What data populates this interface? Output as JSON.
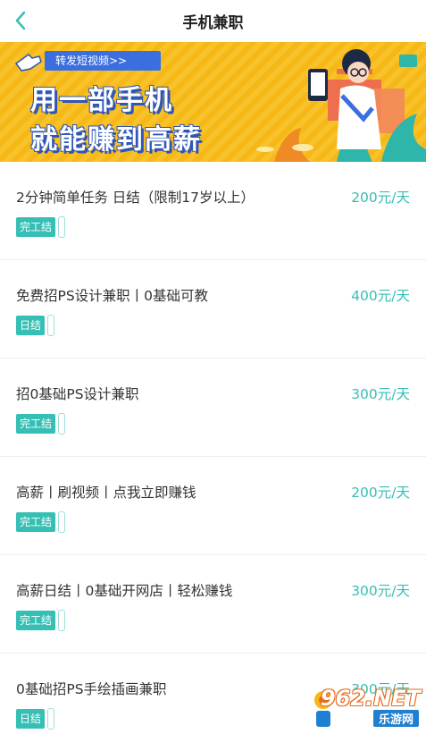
{
  "header": {
    "title": "手机兼职"
  },
  "banner": {
    "tag": "转发短视频>>",
    "line1": "用一部手机",
    "line2": "就能赚到高薪"
  },
  "jobs": [
    {
      "name": "2分钟简单任务 日结（限制17岁以上）",
      "pay": "200元/天",
      "badge": "完工结"
    },
    {
      "name": "免费招PS设计兼职丨0基础可教",
      "pay": "400元/天",
      "badge": "日结"
    },
    {
      "name": "招0基础PS设计兼职",
      "pay": "300元/天",
      "badge": "完工结"
    },
    {
      "name": "高薪丨刷视频丨点我立即赚钱",
      "pay": "200元/天",
      "badge": "完工结"
    },
    {
      "name": "高薪日结丨0基础开网店丨轻松赚钱",
      "pay": "300元/天",
      "badge": "完工结"
    },
    {
      "name": "0基础招PS手绘插画兼职",
      "pay": "300元/天",
      "badge": "日结"
    }
  ],
  "watermark": {
    "main": "962.NET",
    "sub": "乐游网"
  },
  "colors": {
    "accent": "#36bfb4",
    "banner_yellow": "#f8c22a",
    "banner_blue": "#3b6fe0"
  },
  "icons": {
    "back": "chevron-left-icon"
  }
}
